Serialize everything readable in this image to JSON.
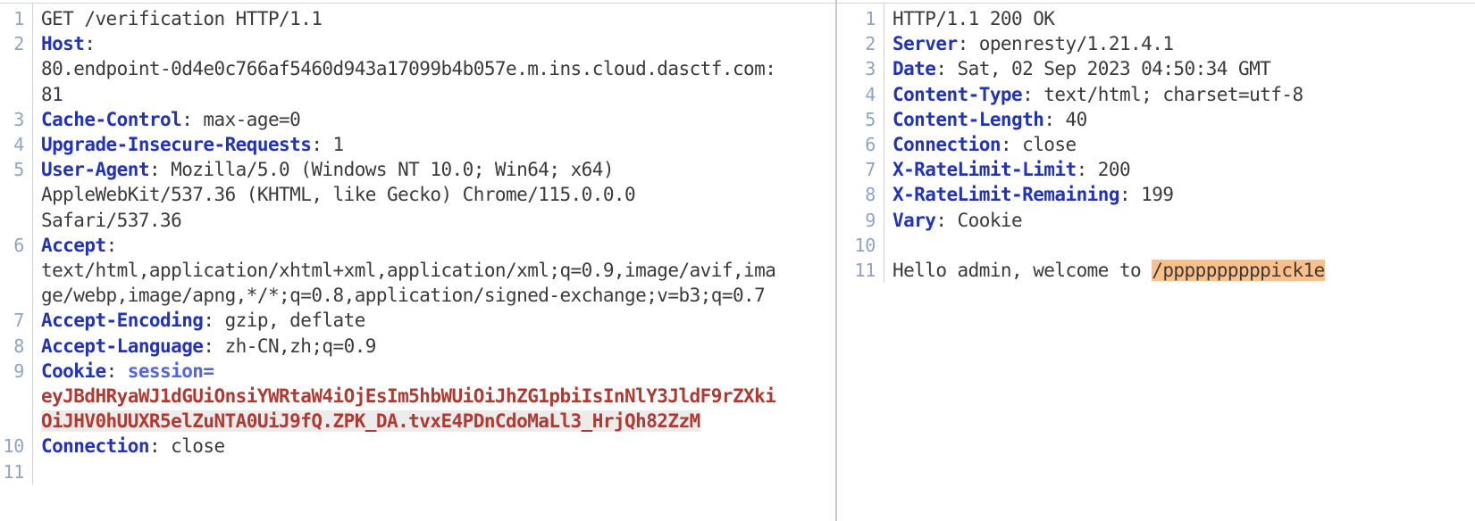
{
  "request": {
    "pane_label": "HTTP request",
    "lines": [
      {
        "num": "1",
        "type": "status",
        "text": "GET /verification HTTP/1.1"
      },
      {
        "num": "2",
        "type": "header",
        "name": "Host",
        "value": ""
      },
      {
        "num": "",
        "type": "wrap",
        "text": "80.endpoint-0d4e0c766af5460d943a17099b4b057e.m.ins.cloud.dasctf.com:"
      },
      {
        "num": "",
        "type": "wrap",
        "text": "81"
      },
      {
        "num": "3",
        "type": "header",
        "name": "Cache-Control",
        "value": " max-age=0"
      },
      {
        "num": "4",
        "type": "header",
        "name": "Upgrade-Insecure-Requests",
        "value": " 1"
      },
      {
        "num": "5",
        "type": "header",
        "name": "User-Agent",
        "value": " Mozilla/5.0 (Windows NT 10.0; Win64; x64)"
      },
      {
        "num": "",
        "type": "wrap",
        "text": "AppleWebKit/537.36 (KHTML, like Gecko) Chrome/115.0.0.0"
      },
      {
        "num": "",
        "type": "wrap",
        "text": "Safari/537.36"
      },
      {
        "num": "6",
        "type": "header",
        "name": "Accept",
        "value": ""
      },
      {
        "num": "",
        "type": "wrap",
        "text": "text/html,application/xhtml+xml,application/xml;q=0.9,image/avif,ima"
      },
      {
        "num": "",
        "type": "wrap",
        "text": "ge/webp,image/apng,*/*;q=0.8,application/signed-exchange;v=b3;q=0.7"
      },
      {
        "num": "7",
        "type": "header",
        "name": "Accept-Encoding",
        "value": " gzip, deflate"
      },
      {
        "num": "8",
        "type": "header",
        "name": "Accept-Language",
        "value": " zh-CN,zh;q=0.9"
      },
      {
        "num": "9",
        "type": "cookie",
        "name": "Cookie",
        "key": " session="
      },
      {
        "num": "",
        "type": "jwt",
        "text": "eyJBdHRyaWJ1dGUiOnsiYWRtaW4iOjEsIm5hbWUiOiJhZG1pbiIsInNlY3JldF9rZXki"
      },
      {
        "num": "",
        "type": "jwt-hl",
        "text": "OiJHV0hUUXR5elZuNTA0UiJ9fQ.ZPK_DA.tvxE4PDnCdoMaLl3_HrjQh82ZzM"
      },
      {
        "num": "10",
        "type": "header",
        "name": "Connection",
        "value": " close"
      },
      {
        "num": "11",
        "type": "empty",
        "text": ""
      }
    ]
  },
  "response": {
    "pane_label": "HTTP response",
    "lines": [
      {
        "num": "1",
        "type": "status",
        "text": "HTTP/1.1 200 OK"
      },
      {
        "num": "2",
        "type": "header",
        "name": "Server",
        "value": " openresty/1.21.4.1"
      },
      {
        "num": "3",
        "type": "header",
        "name": "Date",
        "value": " Sat, 02 Sep 2023 04:50:34 GMT"
      },
      {
        "num": "4",
        "type": "header",
        "name": "Content-Type",
        "value": " text/html; charset=utf-8"
      },
      {
        "num": "5",
        "type": "header",
        "name": "Content-Length",
        "value": " 40"
      },
      {
        "num": "6",
        "type": "header",
        "name": "Connection",
        "value": " close"
      },
      {
        "num": "7",
        "type": "header",
        "name": "X-RateLimit-Limit",
        "value": " 200"
      },
      {
        "num": "8",
        "type": "header",
        "name": "X-RateLimit-Remaining",
        "value": " 199"
      },
      {
        "num": "9",
        "type": "header",
        "name": "Vary",
        "value": " Cookie"
      },
      {
        "num": "10",
        "type": "empty",
        "text": ""
      },
      {
        "num": "11",
        "type": "body",
        "prefix": "Hello admin, welcome to ",
        "highlight": "/ppppppppppick1e"
      }
    ]
  }
}
